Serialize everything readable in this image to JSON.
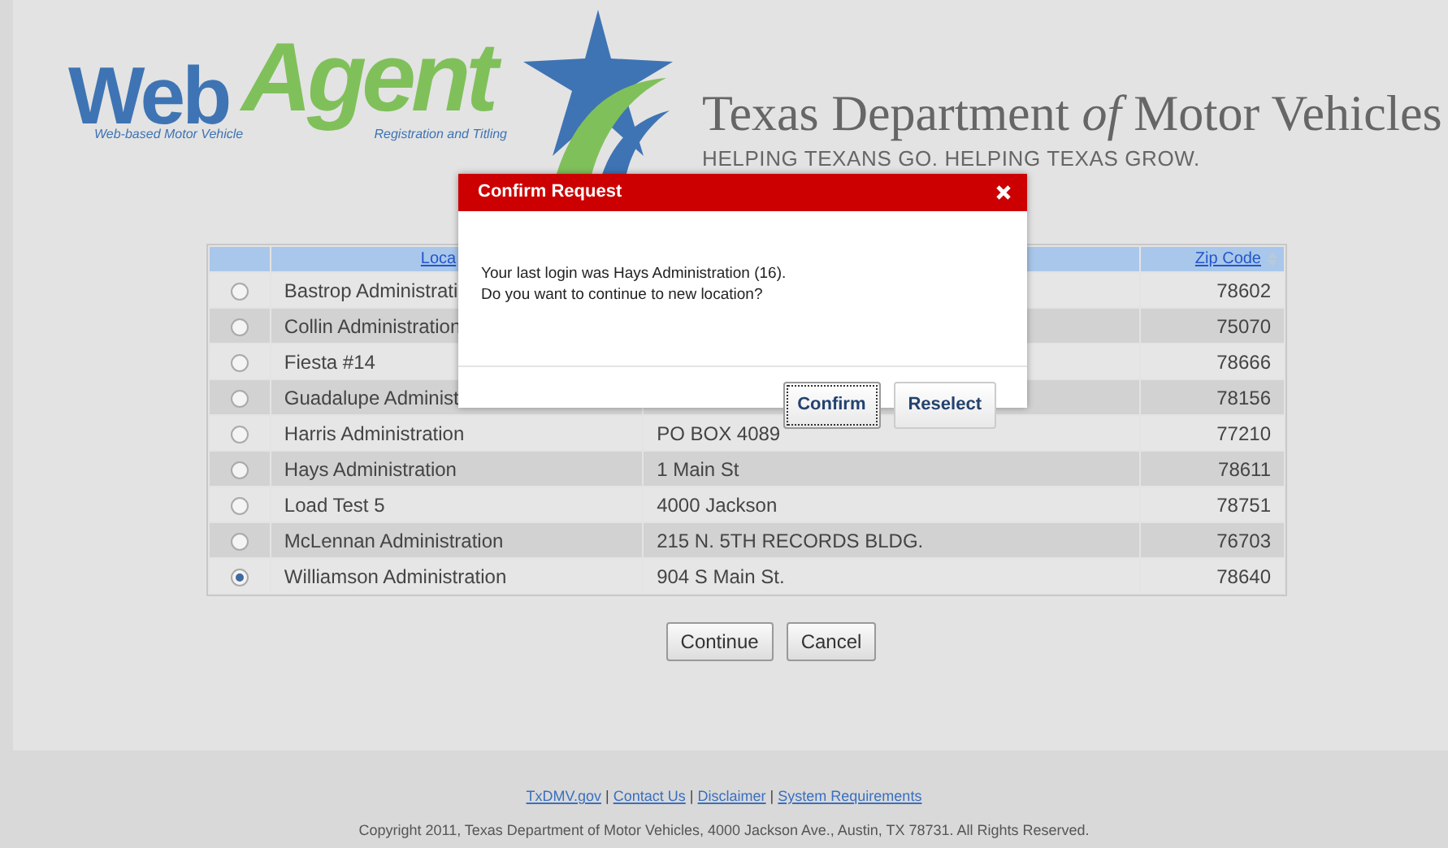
{
  "header": {
    "logo_word_1": "Web",
    "logo_word_2": "Agent",
    "logo_tagline_1": "Web-based Motor Vehicle",
    "logo_tagline_2": "Registration and Titling",
    "agency": "Texas Department *of* Motor Vehicles",
    "slogan": "HELPING TEXANS GO. HELPING TEXAS GROW."
  },
  "table": {
    "columns": [
      {
        "label": "Loca"
      },
      {
        "label": "Zip Code"
      }
    ],
    "rows": [
      {
        "selected": false,
        "location": "Bastrop Administrati",
        "zip": "78602"
      },
      {
        "selected": false,
        "location": "Collin Administration",
        "zip": "75070"
      },
      {
        "selected": false,
        "location": "Fiesta #14",
        "zip": "78666"
      },
      {
        "selected": false,
        "location": "Guadalupe Administ",
        "zip": "78156"
      },
      {
        "selected": false,
        "location": "Harris Administration",
        "address": "PO BOX 4089",
        "zip": "77210"
      },
      {
        "selected": false,
        "location": "Hays Administration",
        "address": "1 Main St",
        "zip": "78611"
      },
      {
        "selected": false,
        "location": "Load Test 5",
        "address": "4000 Jackson",
        "zip": "78751"
      },
      {
        "selected": false,
        "location": "McLennan Administration",
        "address": "215 N. 5TH RECORDS BLDG.",
        "zip": "76703"
      },
      {
        "selected": true,
        "location": "Williamson Administration",
        "address": "904 S Main St.",
        "zip": "78640"
      }
    ]
  },
  "actions": [
    "Continue",
    "Cancel"
  ],
  "dialog": {
    "title": "Confirm Request",
    "message": [
      "Your last login was Hays Administration (16).",
      "Do you want to continue to new location?"
    ],
    "buttons": [
      {
        "label": "Confirm",
        "focused": true
      },
      {
        "label": "Reselect",
        "focused": false
      }
    ]
  },
  "footer": {
    "links": [
      "TxDMV.gov",
      "Contact Us",
      "Disclaimer",
      "System Requirements"
    ],
    "separators": [
      "|",
      "|",
      "|"
    ],
    "copyright": "Copyright 2011, Texas Department of Motor Vehicles, 4000 Jackson Ave., Austin, TX 78731. All Rights Reserved."
  }
}
